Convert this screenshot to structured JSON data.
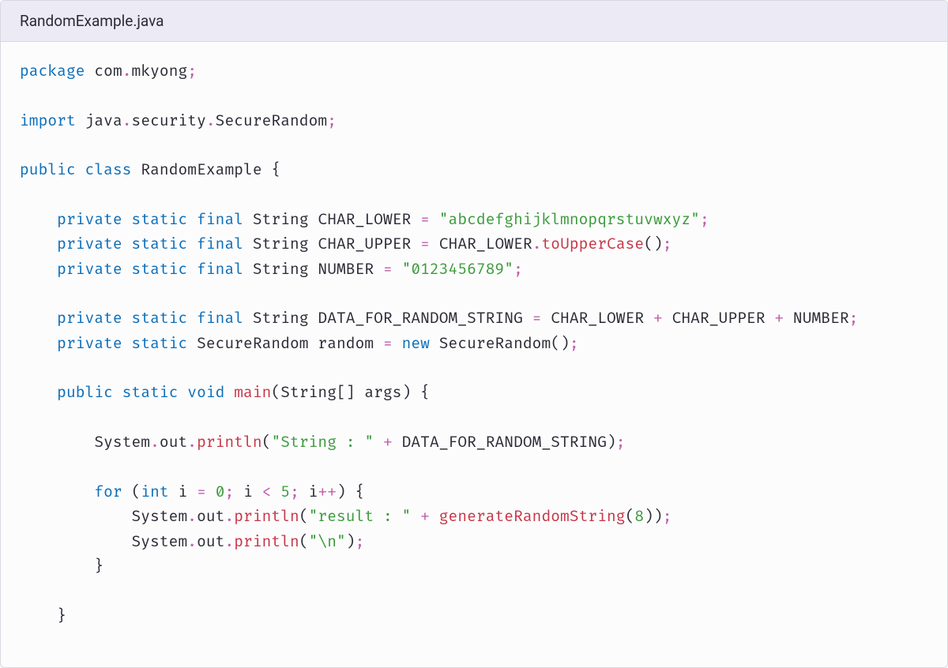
{
  "header": {
    "filename": "RandomExample.java"
  },
  "code": {
    "package_kw": "package",
    "pkg_com": "com",
    "dot": ".",
    "pkg_mkyong": "mkyong",
    "semi": ";",
    "import_kw": "import",
    "pkg_java": "java",
    "pkg_security": "security",
    "type_SecureRandom": "SecureRandom",
    "public_kw": "public",
    "class_kw": "class",
    "class_name": "RandomExample",
    "lbrace": "{",
    "rbrace": "}",
    "private_kw": "private",
    "static_kw": "static",
    "final_kw": "final",
    "type_String": "String",
    "id_CHAR_LOWER": "CHAR_LOWER",
    "eq": "=",
    "str_lower": "\"abcdefghijklmnopqrstuvwxyz\"",
    "id_CHAR_UPPER": "CHAR_UPPER",
    "m_toUpperCase": "toUpperCase",
    "lparen": "(",
    "rparen": ")",
    "id_NUMBER": "NUMBER",
    "str_number": "\"0123456789\"",
    "id_DATA": "DATA_FOR_RANDOM_STRING",
    "plus": "+",
    "id_random": "random",
    "new_kw": "new",
    "void_kw": "void",
    "m_main": "main",
    "lbracket": "[",
    "rbracket": "]",
    "id_args": "args",
    "id_System": "System",
    "id_out": "out",
    "m_println": "println",
    "str_Stringlbl": "\"String : \"",
    "for_kw": "for",
    "int_kw": "int",
    "id_i": "i",
    "num_0": "0",
    "lt": "<",
    "num_5": "5",
    "inc": "++",
    "str_result": "\"result : \"",
    "m_generate": "generateRandomString",
    "num_8": "8",
    "str_nl": "\"\\n\""
  }
}
